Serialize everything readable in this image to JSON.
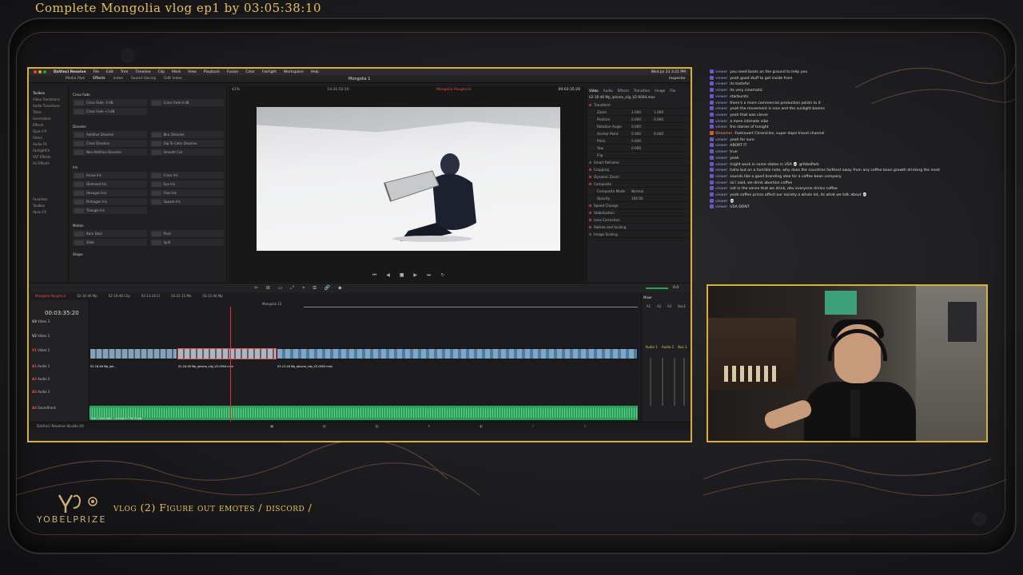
{
  "stream": {
    "title": "Complete Mongolia vlog ep1 by 03:05:38:10",
    "channel_name": "YOBELPRIZE",
    "segment_title": "vlog (2) Figure out emotes / discord /"
  },
  "resolve": {
    "app_name": "DaVinci Resolve",
    "menus": [
      "File",
      "Edit",
      "Trim",
      "Timeline",
      "Clip",
      "Mark",
      "View",
      "Playback",
      "Fusion",
      "Color",
      "Fairlight",
      "Workspace",
      "Help"
    ],
    "clock": "Wed Jul 23  3:21 PM",
    "toolbar_tabs": [
      "Media Pool",
      "Effects",
      "Index",
      "Sound Library",
      "Edit Index"
    ],
    "project_title": "Mongolia 1",
    "viewer_zoom": "41%",
    "viewer_timecode_left": "14:31:52:10",
    "viewer_timecode_right": "00:03:35:20",
    "viewer_clip_name": "Mongolia Roughcut",
    "fx_nav": [
      "Toolbox",
      "Video Transitions",
      "Audio Transitions",
      "Titles",
      "Generators",
      "Effects",
      "Open FX",
      "Filters",
      "Audio FX",
      "FairlightFX",
      "VST Effects",
      "AU Effects",
      "Favorites",
      "Toolbox",
      "Open FX"
    ],
    "fx_sections": [
      {
        "header": "Cross Fade",
        "items": [
          "Cross Fade -3 dB",
          "Cross Fade 0 dB",
          "Cross Fade +3 dB"
        ]
      },
      {
        "header": "Dissolve",
        "items": [
          "Additive Dissolve",
          "Blur Dissolve",
          "Cross Dissolve",
          "Dip To Color Dissolve",
          "Non-Additive Dissolve",
          "Smooth Cut"
        ]
      },
      {
        "header": "Iris",
        "items": [
          "Arrow Iris",
          "Cross Iris",
          "Diamond Iris",
          "Eye Iris",
          "Hexagon Iris",
          "Oval Iris",
          "Pentagon Iris",
          "Square Iris",
          "Triangle Iris"
        ]
      },
      {
        "header": "Motion",
        "items": [
          "Barn Door",
          "Push",
          "Slide",
          "Split"
        ]
      },
      {
        "header": "Shape",
        "items": []
      }
    ],
    "inspector_tabs": [
      "Video",
      "Audio",
      "Effects",
      "Transition",
      "Image",
      "File"
    ],
    "inspector_clip": "02-16-46 Mp_iphone_clip_V2-0004.mov",
    "inspector_sections": [
      {
        "name": "Transform",
        "fields": [
          [
            "Zoom",
            "1.000",
            "1.000"
          ],
          [
            "Position",
            "0.000",
            "0.000"
          ],
          [
            "Rotation Angle",
            "0.000",
            ""
          ],
          [
            "Anchor Point",
            "0.000",
            "0.000"
          ],
          [
            "Pitch",
            "0.000",
            ""
          ],
          [
            "Yaw",
            "0.000",
            ""
          ],
          [
            "Flip",
            "",
            ""
          ]
        ]
      },
      {
        "name": "Smart Reframe"
      },
      {
        "name": "Cropping"
      },
      {
        "name": "Dynamic Zoom"
      },
      {
        "name": "Composite",
        "fields": [
          [
            "Composite Mode",
            "Normal",
            ""
          ],
          [
            "Opacity",
            "100.00",
            ""
          ]
        ]
      },
      {
        "name": "Speed Change"
      },
      {
        "name": "Stabilization"
      },
      {
        "name": "Lens Correction"
      },
      {
        "name": "Retime and Scaling"
      },
      {
        "name": "Image Scaling"
      }
    ],
    "timeline_timecode": "00:03:35:20",
    "timeline_tabs": [
      "Mongolia Roughcut",
      "02-16-46 Mp",
      "02-16-46 Clip",
      "03-13-16 Cl",
      "03-22-15 Me",
      "03-15-40 Mp"
    ],
    "tracks": [
      {
        "id": "V3",
        "name": "Video 3"
      },
      {
        "id": "V2",
        "name": "Video 2"
      },
      {
        "id": "V1",
        "name": "Video 1"
      },
      {
        "id": "A1",
        "name": "Audio 1"
      },
      {
        "id": "A2",
        "name": "Audio 2"
      },
      {
        "id": "A3",
        "name": "Audio 3"
      },
      {
        "id": "A4",
        "name": "Soundtrack"
      }
    ],
    "v1_clip_labels": [
      "02-16-46 Mp_iph..",
      "02-16-46 Mp_iphone_clip..",
      "02-16-46 Mp_iphone_clip_V2-0004.mov",
      "03-13-16 Mp_iphone_clip_V2-0002.mov"
    ],
    "audio_clip_label": "Epic Cinematic - Loving In The Snow",
    "timeline_marker": "Mongolia 1S",
    "mixer_title": "Mixer",
    "mixer_channels": [
      "A1",
      "A2",
      "A3",
      "Bus1"
    ],
    "mixer_labels": [
      "Audio 1",
      "Audio 2",
      "Bus 1"
    ],
    "page_footer": "DaVinci Resolve Studio 20",
    "volume_value": "0.0"
  },
  "chat": [
    {
      "user": "viewer",
      "text": "you need boots on the ground to help you"
    },
    {
      "user": "viewer",
      "text": "yeah good stuff to get inside from"
    },
    {
      "user": "viewer",
      "text": "its tasteful"
    },
    {
      "user": "viewer",
      "text": "its very cinematic"
    },
    {
      "user": "viewer",
      "text": "starbursts"
    },
    {
      "user": "viewer",
      "text": "there's a more commercial production polish to it"
    },
    {
      "user": "viewer",
      "text": "yeah the movement is nice and the sunlight beams"
    },
    {
      "user": "viewer",
      "text": "yeah that was clever"
    },
    {
      "user": "viewer",
      "text": "a more intimate vibe"
    },
    {
      "user": "viewer",
      "text": "the stories of tonight"
    },
    {
      "user": "Streamer",
      "text": "Foxtrovert Chronicles, super dope travel channel"
    },
    {
      "user": "viewer",
      "text": "yeah for sure"
    },
    {
      "user": "viewer",
      "text": "ABORT IT"
    },
    {
      "user": "viewer",
      "text": "true"
    },
    {
      "user": "viewer",
      "text": "yeah"
    },
    {
      "user": "viewer",
      "text": "might work in some states in USA 💀 @YoboPark"
    },
    {
      "user": "viewer",
      "text": "haha but on a horrible note, why does the countries farthest away from any coffee bean growth drinking the most"
    },
    {
      "user": "viewer",
      "text": "sounds like a good branding idea for a coffee bean company"
    },
    {
      "user": "viewer",
      "text": "lol i said, we drink abortion coffee"
    },
    {
      "user": "viewer",
      "text": "not in the sense that we drink, obv everyone drinks coffee"
    },
    {
      "user": "viewer",
      "text": "yeah coffee prices affect our society a whole lot, its what we talk about 💀"
    },
    {
      "user": "viewer",
      "text": "💀"
    },
    {
      "user": "viewer",
      "text": "USA DONT"
    }
  ],
  "colors": {
    "accent_gold": "#d6b13a",
    "title_gold": "#e8c34a",
    "timeline_clip_blue": "#3d7fb0",
    "audio_green": "#2aa05a",
    "playhead_red": "#e03030"
  },
  "icons": [
    "logo-icon",
    "person-in-snow-video",
    "webcam-feed"
  ]
}
